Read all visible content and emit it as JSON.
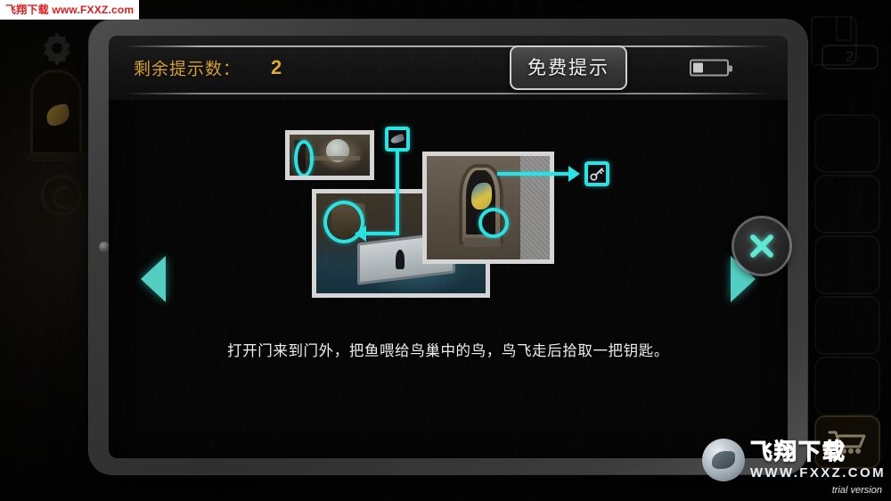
{
  "header": {
    "hint_label": "剩余提示数：",
    "hint_count": "2",
    "free_hint_button": "免费提示",
    "battery_icon": "battery-icon"
  },
  "hint": {
    "caption": "打开门来到门外，把鱼喂给鸟巢中的鸟，鸟飞走后拾取一把钥匙。",
    "screenshots": [
      {
        "name": "room-interior",
        "highlight": "door"
      },
      {
        "name": "bathroom-nest",
        "highlight": "nest"
      },
      {
        "name": "outdoor-birdhouse",
        "highlight": "bird"
      }
    ],
    "items": [
      {
        "name": "fish-item",
        "icon": "fish-icon"
      },
      {
        "name": "key-item",
        "icon": "key-icon"
      }
    ]
  },
  "nav": {
    "prev": "prev-arrow",
    "next": "next-arrow",
    "close": "close-icon"
  },
  "background": {
    "notebook_badge": "2",
    "gear_icon": "gear-icon",
    "cart_icon": "shopping-cart-icon"
  },
  "watermark": {
    "top": "飞翔下载 www.FXXZ.com",
    "logo_cn": "飞翔下载",
    "logo_en": "WWW.FXXZ.COM",
    "trial": "trial version"
  },
  "colors": {
    "accent_cyan": "#27e3e3",
    "gold": "#d8a423",
    "nav_teal": "#52cfc0"
  }
}
